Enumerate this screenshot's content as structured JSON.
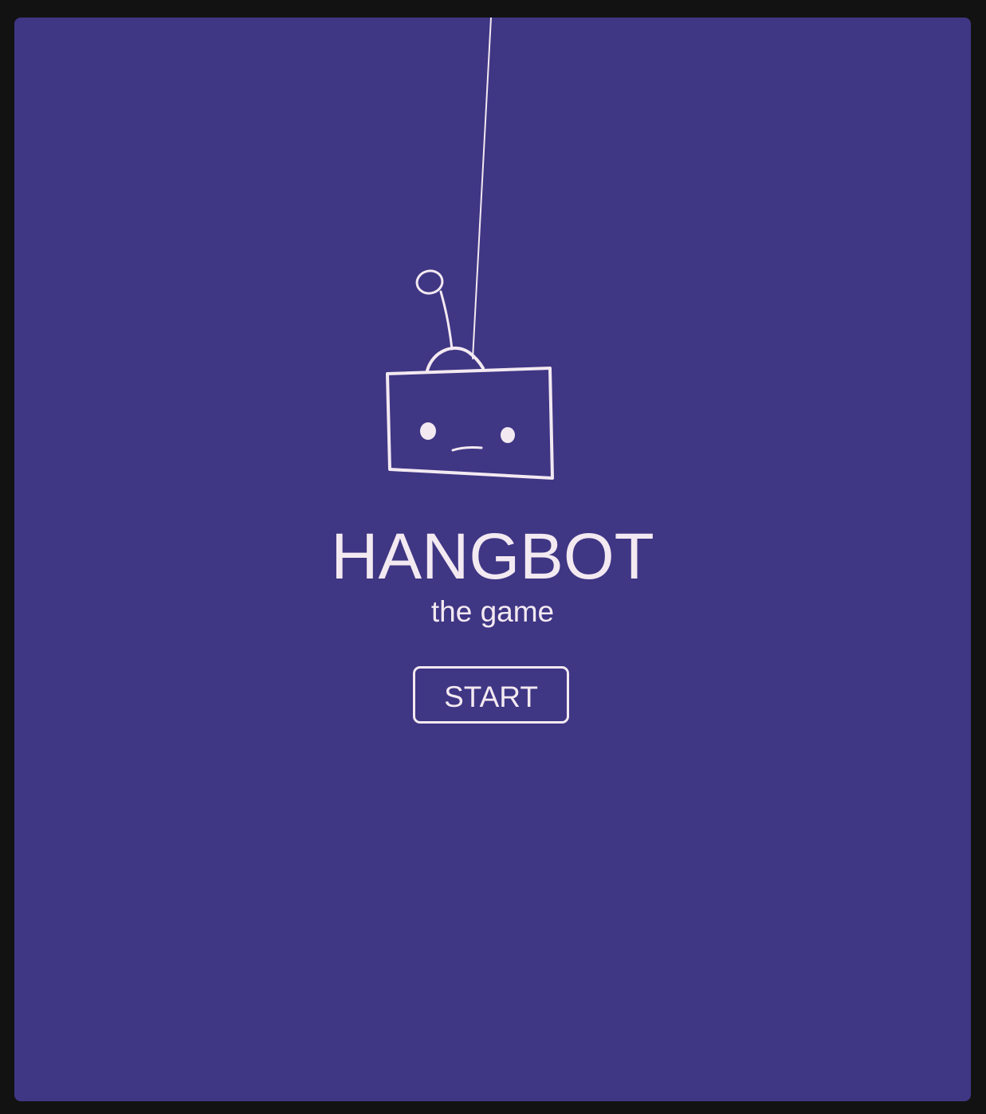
{
  "game": {
    "title": "HANGBOT",
    "subtitle": "the game",
    "start_label": "START"
  },
  "colors": {
    "background": "#3f3684",
    "foreground": "#f3e9f1",
    "outer_frame": "#121212"
  },
  "illustration": {
    "subject": "robot-head-hanging-from-string",
    "icon": "robot-icon"
  }
}
